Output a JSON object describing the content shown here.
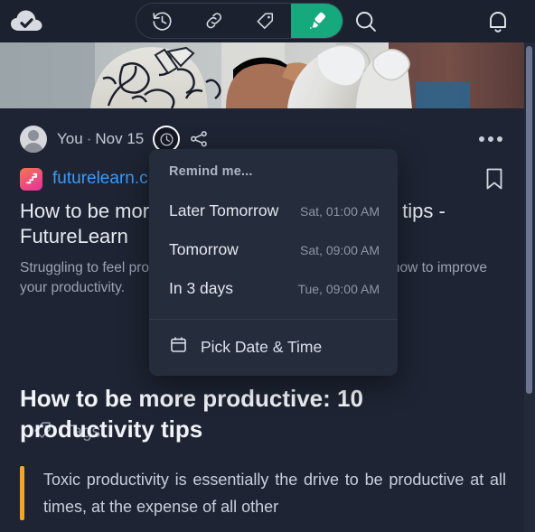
{
  "colors": {
    "page_bg": "#1e2433",
    "topbar_bg": "#1b212e",
    "accent_green": "#16a97d",
    "link_blue": "#3d9bf5",
    "highlight_orange": "#f5a524",
    "menu_bg": "#252c3c",
    "scrollbar_thumb": "#6b7590"
  },
  "topbar": {
    "logo_icon": "cloud-check-icon",
    "tools": [
      {
        "icon": "history-clock-icon",
        "label": "History",
        "active": false
      },
      {
        "icon": "link-icon",
        "label": "Link",
        "active": false
      },
      {
        "icon": "tag-icon",
        "label": "Tag",
        "active": false
      },
      {
        "icon": "highlighter-icon",
        "label": "Highlighter",
        "active": true
      }
    ],
    "search_icon": "search-icon",
    "notifications_icon": "bell-icon"
  },
  "card": {
    "author": "You",
    "separator": "·",
    "date": "Nov 15",
    "reminder_icon": "clock-icon",
    "share_icon": "share-icon",
    "more_icon": "ellipsis-icon",
    "favicon_icon": "futurelearn-favicon",
    "site_link": "futurelearn.c",
    "bookmark_icon": "bookmark-icon",
    "article_title": "How to be more productive: 10 productivity tips - FutureLearn",
    "article_description": "Struggling to feel productive? Here are 10 tips and tricks on how to improve your productivity.",
    "tags_icon": "tag-icon",
    "tags_label": "Tags"
  },
  "reminder_menu": {
    "header": "Remind me...",
    "items": [
      {
        "label": "Later Tomorrow",
        "time": "Sat, 01:00 AM"
      },
      {
        "label": "Tomorrow",
        "time": "Sat, 09:00 AM"
      },
      {
        "label": "In 3 days",
        "time": "Tue, 09:00 AM"
      }
    ],
    "footer_icon": "calendar-icon",
    "footer_label": "Pick Date & Time"
  },
  "reader": {
    "title": "How to be more productive: 10 productivity tips",
    "quote": "Toxic productivity is essentially the drive to be productive at all times, at the expense of all other"
  }
}
